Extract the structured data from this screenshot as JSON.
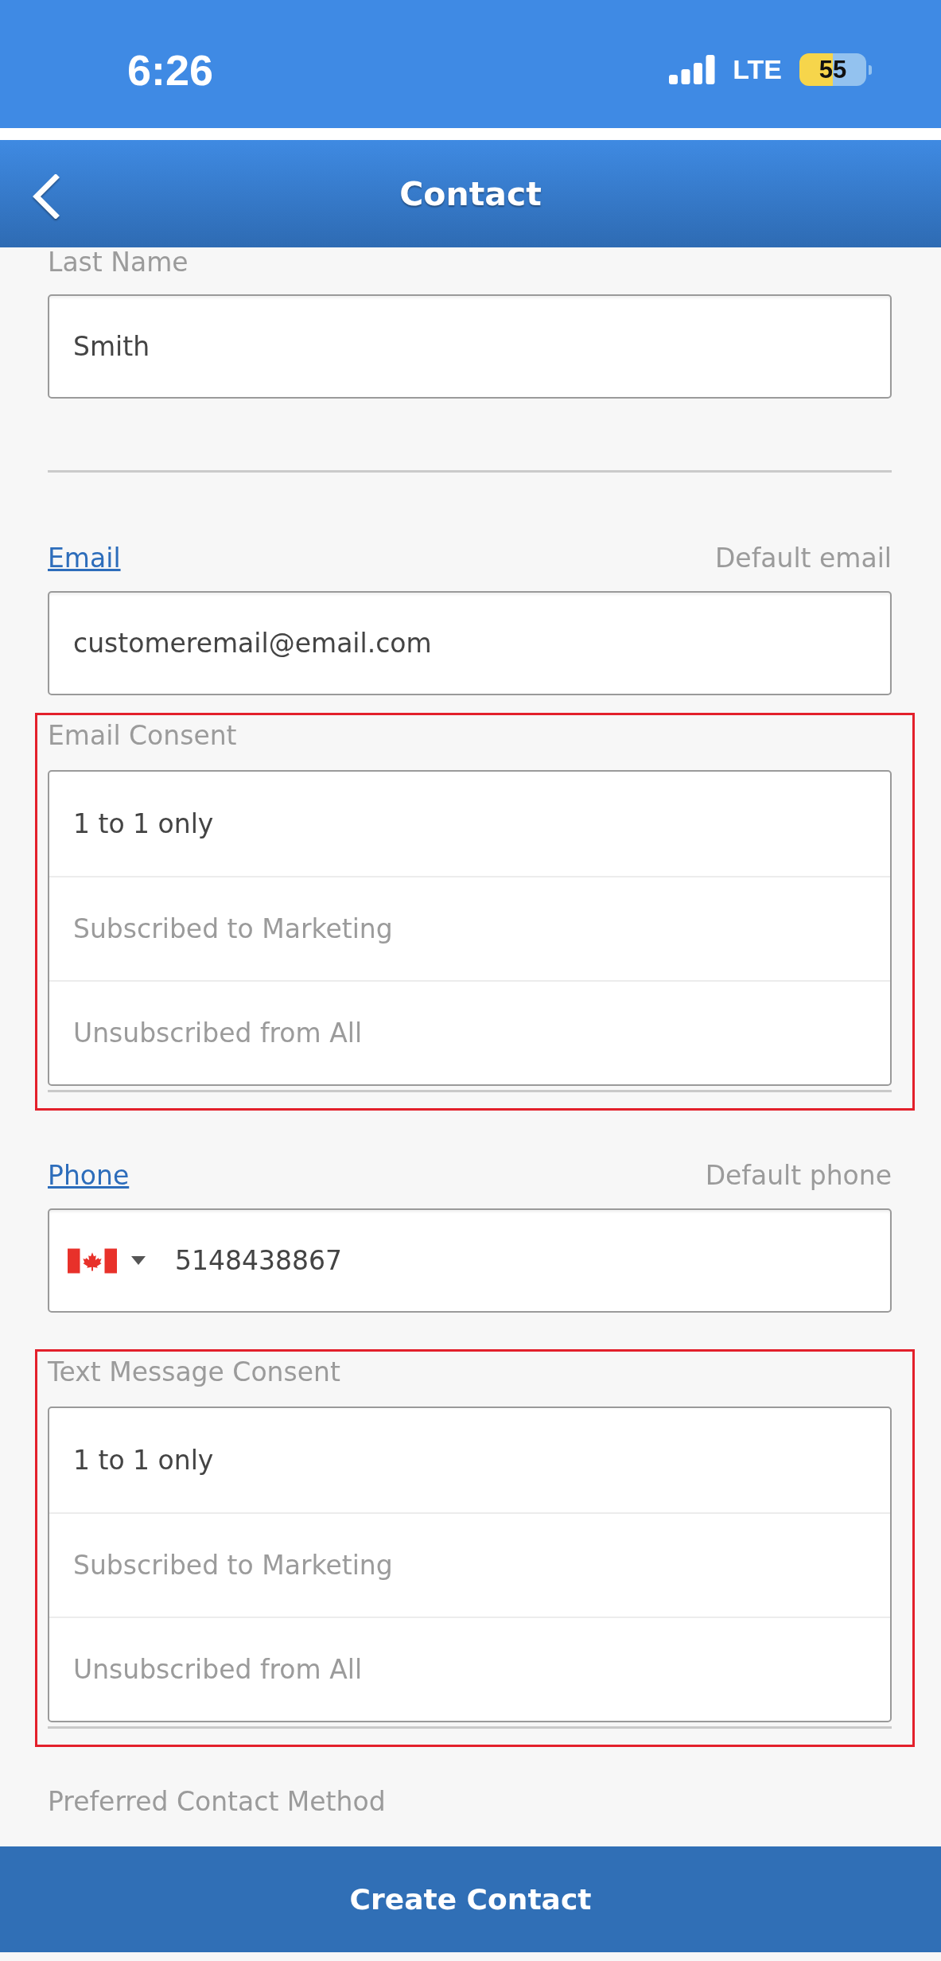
{
  "status_bar": {
    "time": "6:26",
    "network": "LTE",
    "battery": "55"
  },
  "nav_bar": {
    "title": "Contact"
  },
  "last_name": {
    "label": "Last Name",
    "value": "Smith"
  },
  "email": {
    "label": "Email",
    "default_label": "Default email",
    "value": "customeremail@email.com"
  },
  "email_consent": {
    "label": "Email Consent",
    "highlighted": true,
    "options": [
      {
        "label": "1 to 1 only",
        "selected": true
      },
      {
        "label": "Subscribed to Marketing",
        "selected": false
      },
      {
        "label": "Unsubscribed from All",
        "selected": false
      }
    ]
  },
  "phone": {
    "label": "Phone",
    "default_label": "Default phone",
    "value": "5148438867"
  },
  "text_consent": {
    "label": "Text Message Consent",
    "highlighted": true,
    "options": [
      {
        "label": "1 to 1 only",
        "selected": true
      },
      {
        "label": "Subscribed to Marketing",
        "selected": false
      },
      {
        "label": "Unsubscribed from All",
        "selected": false
      }
    ]
  },
  "preferred_contact": {
    "label": "Preferred Contact Method"
  },
  "create_button": {
    "label": "Create Contact"
  }
}
